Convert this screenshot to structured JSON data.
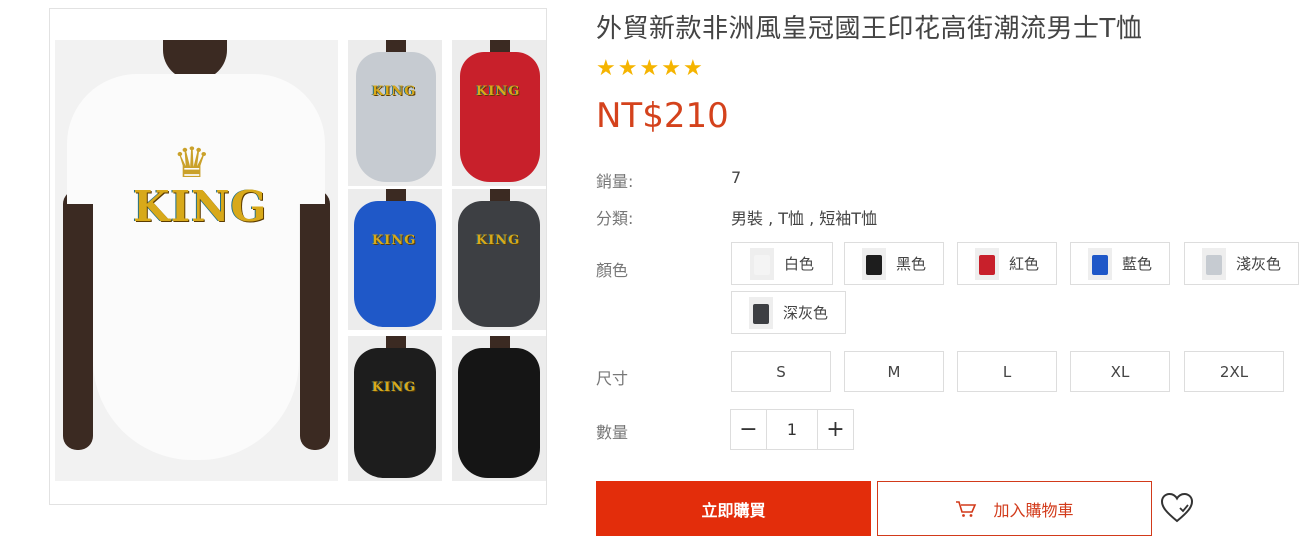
{
  "product": {
    "title": "外貿新款非洲風皇冠國王印花高街潮流男士T恤",
    "rating_stars": 5,
    "price": "NT$210",
    "image_print_text": "KING"
  },
  "details": {
    "sales_label": "銷量:",
    "sales_value": "7",
    "category_label": "分類:",
    "category_value": "男裝 , T恤 , 短袖T恤"
  },
  "color": {
    "label": "顏色",
    "options": [
      {
        "name": "白色",
        "swatch": "#f4f4f4"
      },
      {
        "name": "黑色",
        "swatch": "#1d1d1d"
      },
      {
        "name": "紅色",
        "swatch": "#c8202b"
      },
      {
        "name": "藍色",
        "swatch": "#1f58c8"
      },
      {
        "name": "淺灰色",
        "swatch": "#c6cbd1"
      },
      {
        "name": "深灰色",
        "swatch": "#3d3f43"
      }
    ]
  },
  "size": {
    "label": "尺寸",
    "options": [
      "S",
      "M",
      "L",
      "XL",
      "2XL"
    ]
  },
  "quantity": {
    "label": "數量",
    "value": "1",
    "minus": "−",
    "plus": "+"
  },
  "actions": {
    "buy_now": "立即購買",
    "add_to_cart": "加入購物車"
  },
  "colors": {
    "accent": "#e32d0b",
    "price": "#d4421c",
    "star": "#f5b400"
  }
}
